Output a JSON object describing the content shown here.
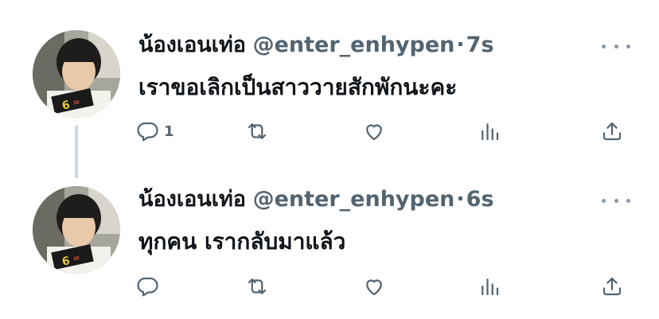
{
  "tweets": [
    {
      "name": "น้องเอนเท่อ",
      "handle": "@enter_enhypen",
      "separator": "·",
      "time": "7s",
      "text": "เราขอเลิกเป็นสาววายสักพักนะคะ",
      "reply_count": "1"
    },
    {
      "name": "น้องเอนเท่อ",
      "handle": "@enter_enhypen",
      "separator": "·",
      "time": "6s",
      "text": "ทุกคน เรากลับมาแล้ว",
      "reply_count": ""
    }
  ],
  "icons": {
    "reply": "reply-icon",
    "retweet": "retweet-icon",
    "like": "heart-icon",
    "views": "views-icon",
    "share": "share-icon",
    "more": "more-icon"
  }
}
